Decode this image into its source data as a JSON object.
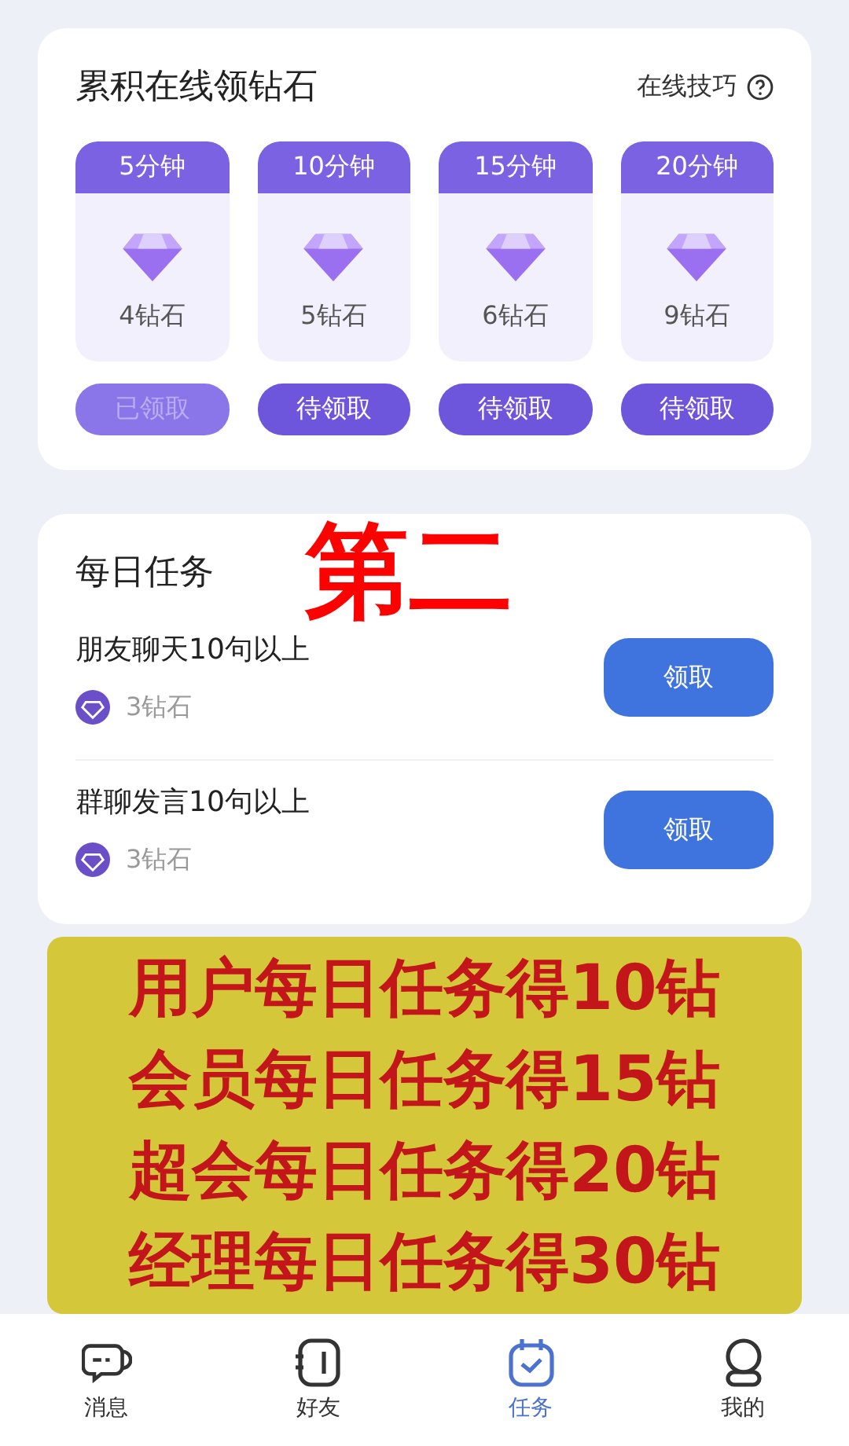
{
  "online_card": {
    "title": "累积在线领钻石",
    "tips_link": "在线技巧",
    "rewards": [
      {
        "duration": "5分钟",
        "amount": "4钻石",
        "button": "已领取",
        "claimed": true
      },
      {
        "duration": "10分钟",
        "amount": "5钻石",
        "button": "待领取",
        "claimed": false
      },
      {
        "duration": "15分钟",
        "amount": "6钻石",
        "button": "待领取",
        "claimed": false
      },
      {
        "duration": "20分钟",
        "amount": "9钻石",
        "button": "待领取",
        "claimed": false
      }
    ]
  },
  "daily_card": {
    "title": "每日任务",
    "overlay_label": "第二",
    "tasks": [
      {
        "name": "朋友聊天10句以上",
        "reward": "3钻石",
        "button": "领取"
      },
      {
        "name": "群聊发言10句以上",
        "reward": "3钻石",
        "button": "领取"
      }
    ]
  },
  "banner_lines": [
    "用户每日任务得10钻",
    "会员每日任务得15钻",
    "超会每日任务得20钻",
    "经理每日任务得30钻"
  ],
  "tab_bar": [
    {
      "label": "消息",
      "selected": false
    },
    {
      "label": "好友",
      "selected": false
    },
    {
      "label": "任务",
      "selected": true
    },
    {
      "label": "我的",
      "selected": false
    }
  ]
}
